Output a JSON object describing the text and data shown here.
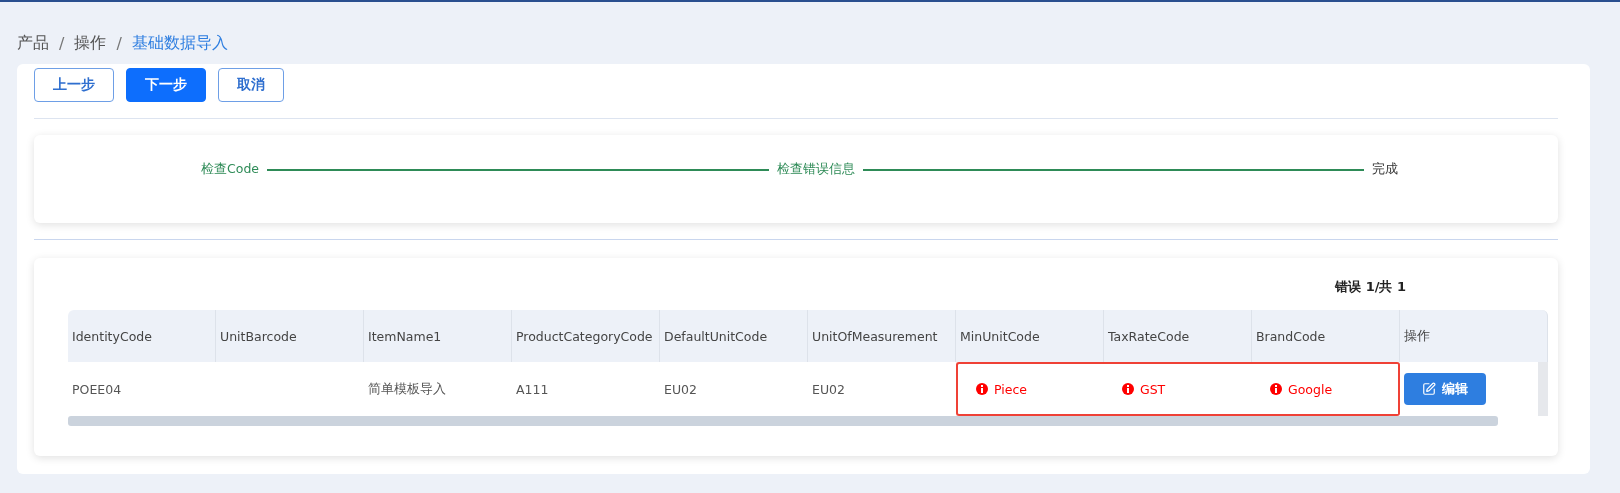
{
  "breadcrumb_separator": "/",
  "breadcrumb": [
    {
      "label": "产品",
      "selected": false
    },
    {
      "label": "操作",
      "selected": false
    },
    {
      "label": "基础数据导入",
      "selected": true
    }
  ],
  "buttons": [
    {
      "label": "上一步",
      "kind": "default"
    },
    {
      "label": "下一步",
      "kind": "primary"
    },
    {
      "label": "取消",
      "kind": "default"
    }
  ],
  "steps": [
    {
      "label": "检查Code",
      "done": true
    },
    {
      "label": "检查错误信息",
      "done": true
    },
    {
      "label": "完成",
      "done": false
    }
  ],
  "error_count": "错误 1/共 1",
  "table": {
    "columns": [
      "IdentityCode",
      "UnitBarcode",
      "ItemName1",
      "ProductCategoryCode",
      "DefaultUnitCode",
      "UnitOfMeasurement",
      "MinUnitCode",
      "TaxRateCode",
      "BrandCode",
      "操作"
    ],
    "rows": [
      {
        "cells": [
          {
            "text": "POEE04",
            "kind": "text"
          },
          {
            "text": "",
            "kind": "text"
          },
          {
            "text": "简单模板导入",
            "kind": "text"
          },
          {
            "text": "A111",
            "kind": "text"
          },
          {
            "text": "EU02",
            "kind": "text"
          },
          {
            "text": "EU02",
            "kind": "text"
          },
          {
            "text": "Piece",
            "kind": "error"
          },
          {
            "text": "GST",
            "kind": "error"
          },
          {
            "text": "Google",
            "kind": "error"
          }
        ],
        "action": "编辑"
      }
    ]
  }
}
